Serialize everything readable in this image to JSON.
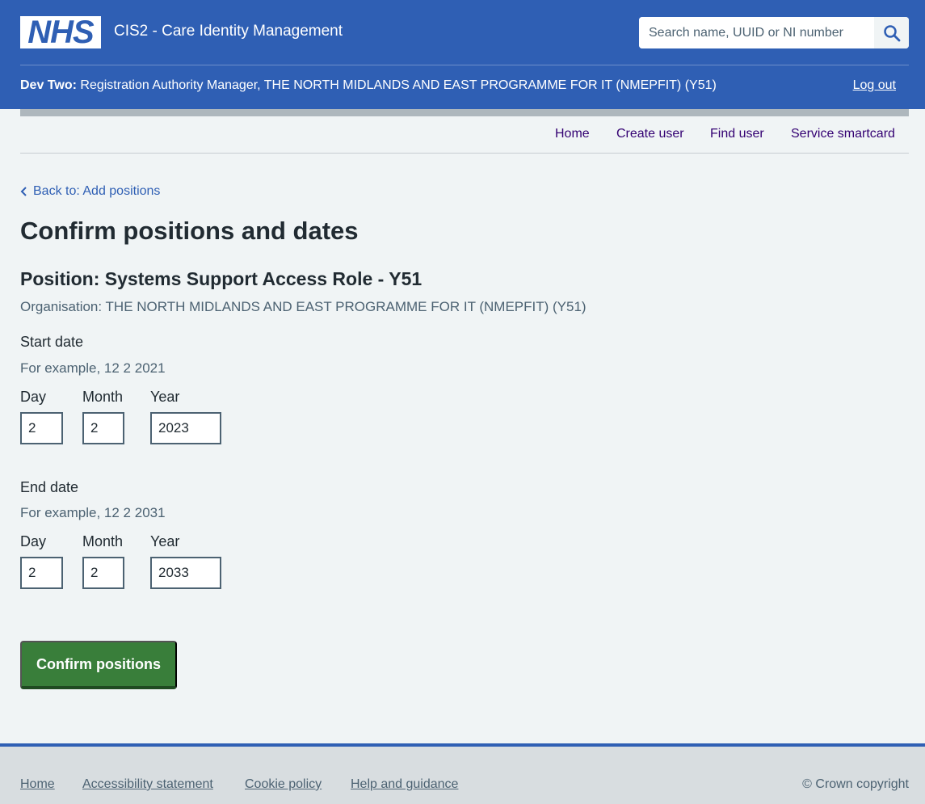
{
  "header": {
    "logo_text": "NHS",
    "service_name": "CIS2 - Care Identity Management",
    "search_placeholder": "Search name, UUID or NI number",
    "user_name": "Dev Two:",
    "user_role": " Registration Authority Manager, THE NORTH MIDLANDS AND EAST PROGRAMME FOR IT (NMEPFIT) (Y51)",
    "logout_label": "Log out"
  },
  "nav": {
    "items": [
      "Home",
      "Create user",
      "Find user",
      "Service smartcard"
    ]
  },
  "back_link": "Back to: Add positions",
  "page_title": "Confirm positions and dates",
  "position": {
    "title": "Position: Systems Support Access Role - Y51",
    "organisation": "Organisation: THE NORTH MIDLANDS AND EAST PROGRAMME FOR IT (NMEPFIT) (Y51)"
  },
  "start_date": {
    "label": "Start date",
    "hint": "For example, 12 2 2021",
    "day_label": "Day",
    "month_label": "Month",
    "year_label": "Year",
    "day": "2",
    "month": "2",
    "year": "2023"
  },
  "end_date": {
    "label": "End date",
    "hint": "For example, 12 2 2031",
    "day_label": "Day",
    "month_label": "Month",
    "year_label": "Year",
    "day": "2",
    "month": "2",
    "year": "2033"
  },
  "confirm_button": "Confirm positions",
  "footer": {
    "links": [
      "Home",
      "Accessibility statement",
      "Cookie policy",
      "Help and guidance"
    ],
    "copyright": "© Crown copyright"
  },
  "colors": {
    "brand_blue": "#2f5fb4",
    "button_green": "#397e3a",
    "nav_link": "#330072"
  },
  "icons": [
    "search-icon",
    "chevron-left-icon"
  ]
}
